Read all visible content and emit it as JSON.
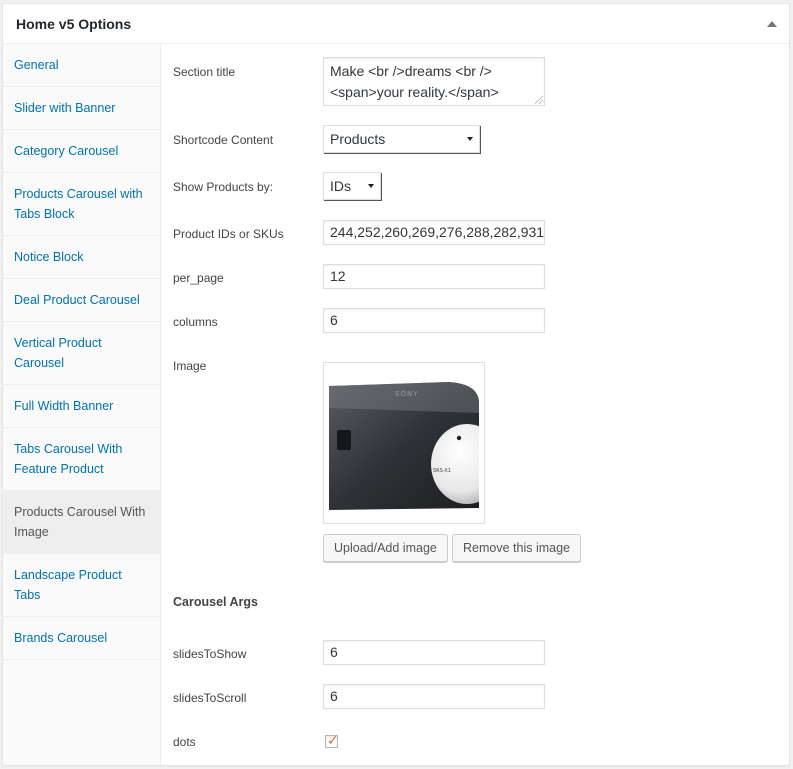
{
  "postbox": {
    "title": "Home v5 Options"
  },
  "tabs": [
    {
      "label": "General"
    },
    {
      "label": "Slider with Banner"
    },
    {
      "label": "Category Carousel"
    },
    {
      "label": "Products Carousel with Tabs Block"
    },
    {
      "label": "Notice Block"
    },
    {
      "label": "Deal Product Carousel"
    },
    {
      "label": "Vertical Product Carousel"
    },
    {
      "label": "Full Width Banner"
    },
    {
      "label": "Tabs Carousel With Feature Product"
    },
    {
      "label": "Products Carousel With Image"
    },
    {
      "label": "Landscape Product Tabs"
    },
    {
      "label": "Brands Carousel"
    }
  ],
  "active_tab": "Products Carousel With Image",
  "form": {
    "section_title": {
      "label": "Section title",
      "value": "Make <br />dreams <br /><span>your reality.</span>"
    },
    "shortcode_content": {
      "label": "Shortcode Content",
      "value": "Products"
    },
    "show_products_by": {
      "label": "Show Products by:",
      "value": "IDs"
    },
    "product_ids": {
      "label": "Product IDs or SKUs",
      "value": "244,252,260,269,276,288,282,931"
    },
    "per_page": {
      "label": "per_page",
      "value": "12"
    },
    "columns": {
      "label": "columns",
      "value": "6"
    },
    "image": {
      "label": "Image",
      "upload_button": "Upload/Add image",
      "remove_button": "Remove this image",
      "brand_text": "SONY",
      "speaker_text": "SRS-X1"
    },
    "carousel_args": {
      "heading": "Carousel Args"
    },
    "slides_to_show": {
      "label": "slidesToShow",
      "value": "6"
    },
    "slides_to_scroll": {
      "label": "slidesToScroll",
      "value": "6"
    },
    "dots": {
      "label": "dots",
      "checked": true
    }
  },
  "colors": {
    "link": "#0073aa",
    "checkmark": "#e0662a",
    "active_tab_bg": "#eeeeee"
  }
}
